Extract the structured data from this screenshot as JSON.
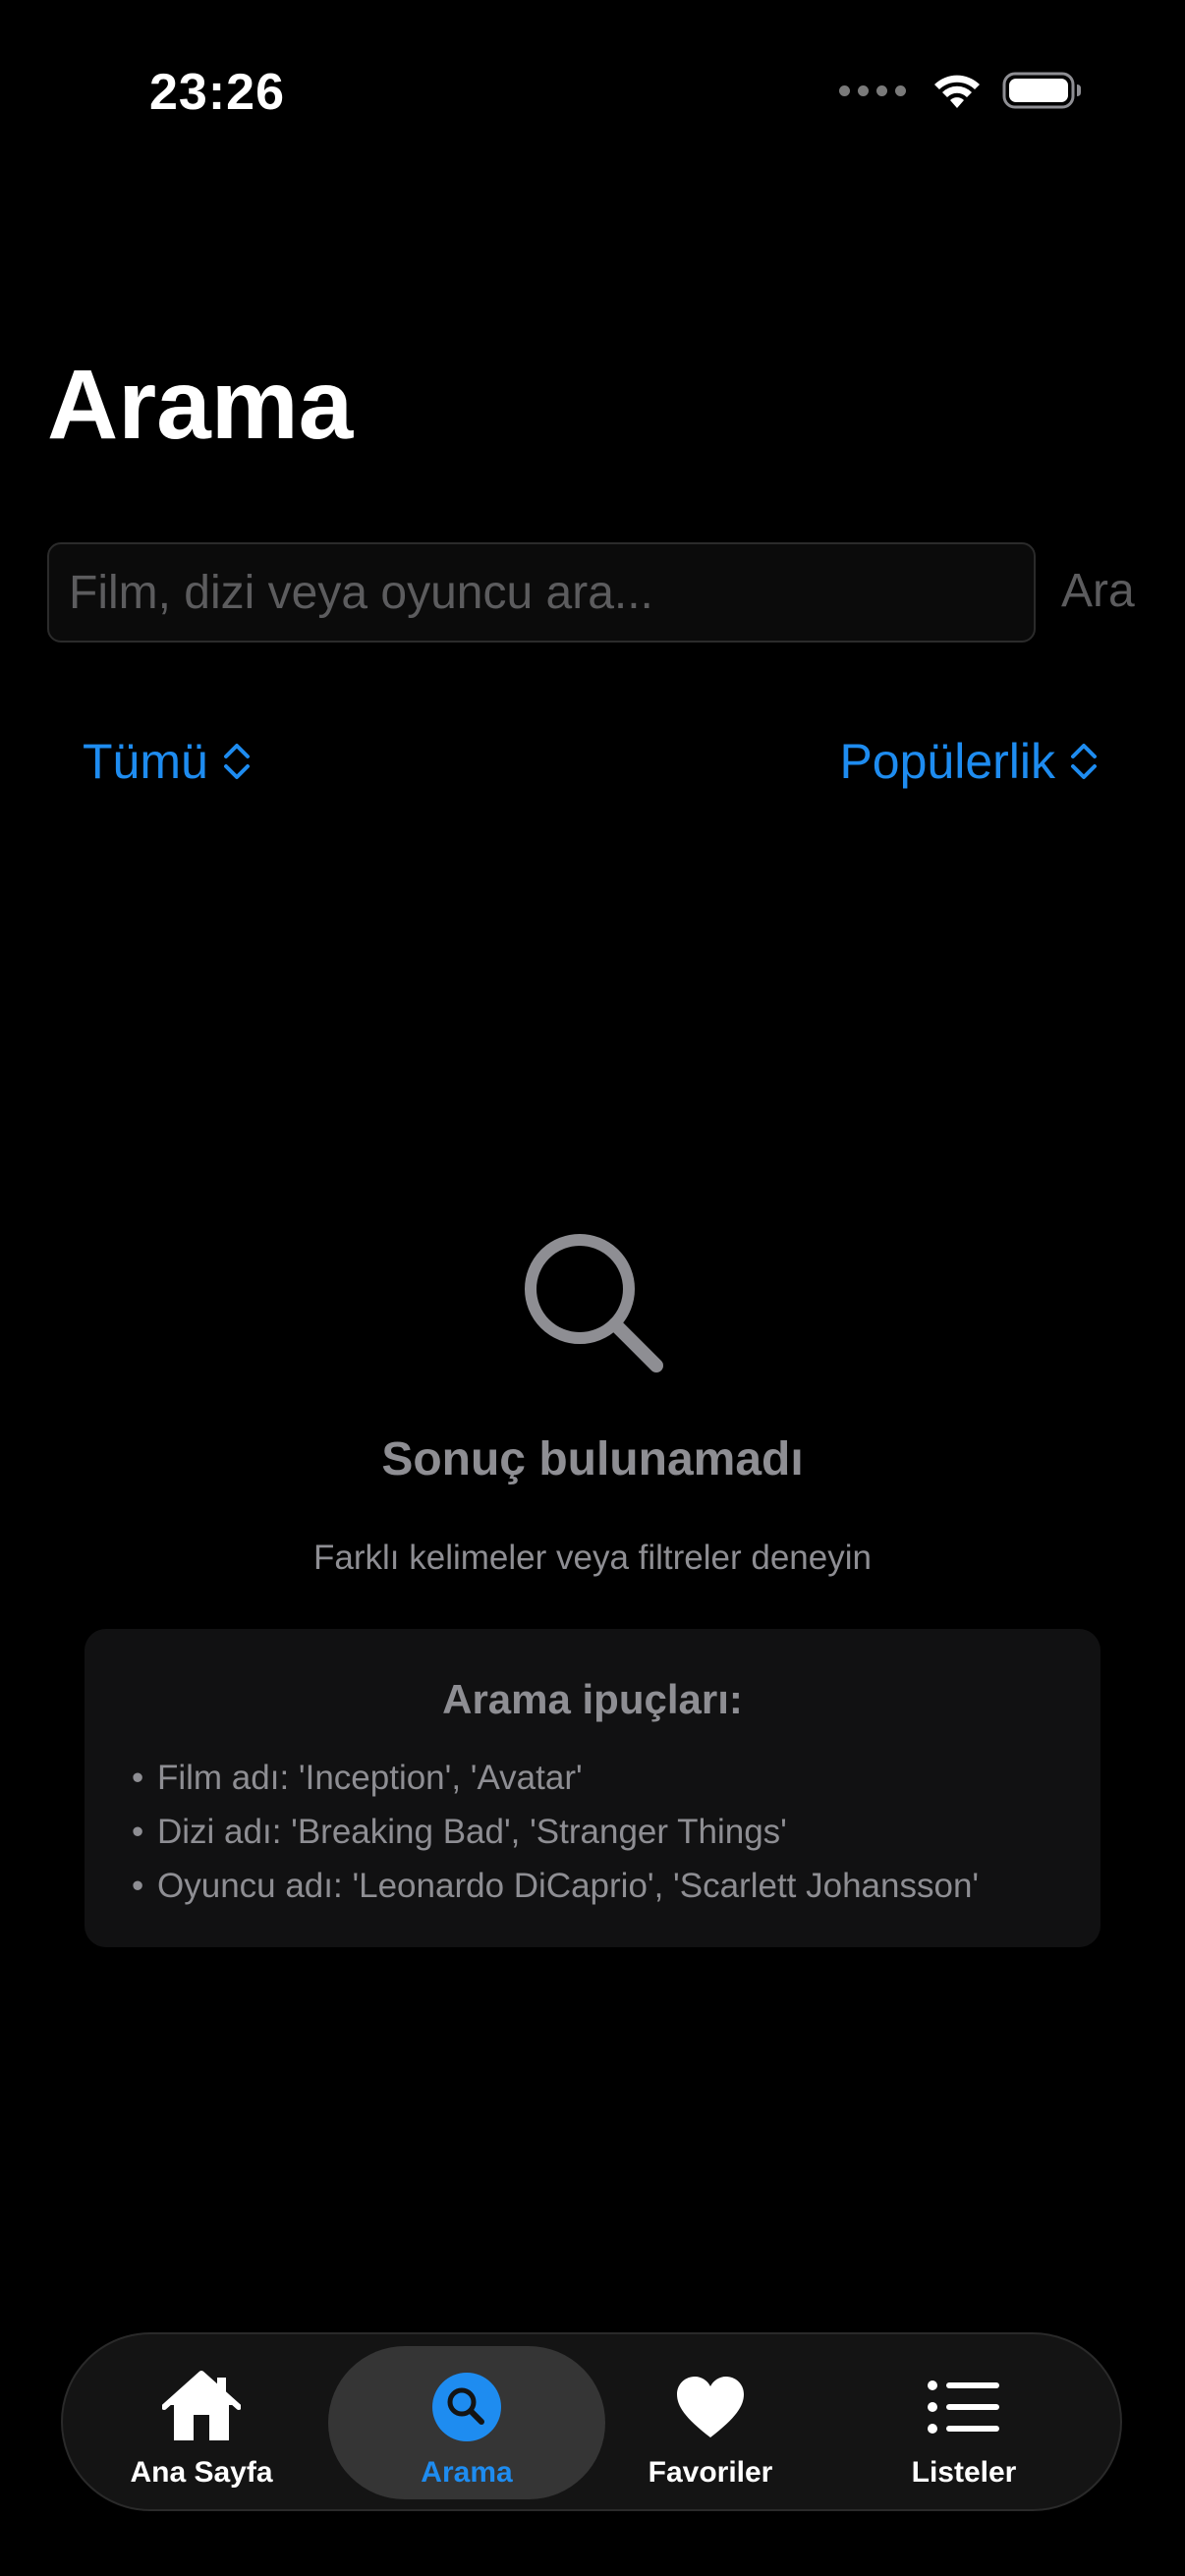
{
  "status_bar": {
    "time": "23:26",
    "icons": [
      "signal-icon",
      "wifi-icon",
      "battery-icon"
    ]
  },
  "header": {
    "title": "Arama"
  },
  "search": {
    "placeholder": "Film, dizi veya oyuncu ara...",
    "value": "",
    "button_label": "Ara"
  },
  "filters": {
    "type_label": "Tümü",
    "sort_label": "Popülerlik",
    "accent_color": "#1E8CF0"
  },
  "empty_state": {
    "icon": "magnifying-glass-icon",
    "title": "Sonuç bulunamadı",
    "subtitle": "Farklı kelimeler veya filtreler deneyin"
  },
  "tips": {
    "title": "Arama ipuçları:",
    "items": [
      "Film adı: 'Inception', 'Avatar'",
      "Dizi adı: 'Breaking Bad', 'Stranger Things'",
      "Oyuncu adı: 'Leonardo DiCaprio', 'Scarlett Johansson'"
    ]
  },
  "tab_bar": {
    "active": "Arama",
    "tabs": [
      {
        "label": "Ana Sayfa",
        "icon": "house-icon"
      },
      {
        "label": "Arama",
        "icon": "search-icon"
      },
      {
        "label": "Favoriler",
        "icon": "heart-icon"
      },
      {
        "label": "Listeler",
        "icon": "list-icon"
      }
    ]
  }
}
